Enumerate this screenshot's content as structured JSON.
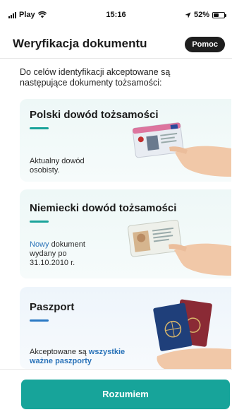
{
  "status_bar": {
    "carrier": "Play",
    "time": "15:16",
    "battery": "52%",
    "battery_level": 0.52
  },
  "header": {
    "title": "Weryfikacja dokumentu",
    "help_label": "Pomoc"
  },
  "intro": "Do celów identyfikacji akceptowane są następujące dokumenty tożsamości:",
  "cards": [
    {
      "title": "Polski dowód tożsamości",
      "desc": "Aktualny dowód osobisty."
    },
    {
      "title": "Niemiecki dowód tożsamości",
      "desc_highlight": "Nowy",
      "desc_rest": " dokument wydany po 31.10.2010 r."
    },
    {
      "title": "Paszport",
      "desc_pre": "Akceptowane są ",
      "desc_highlight": "wszystkie ważne paszporty"
    }
  ],
  "footer": {
    "button_label": "Rozumiem"
  },
  "colors": {
    "accent_teal": "#1aa39a",
    "accent_blue": "#2a79c4",
    "button": "#17a49a"
  }
}
